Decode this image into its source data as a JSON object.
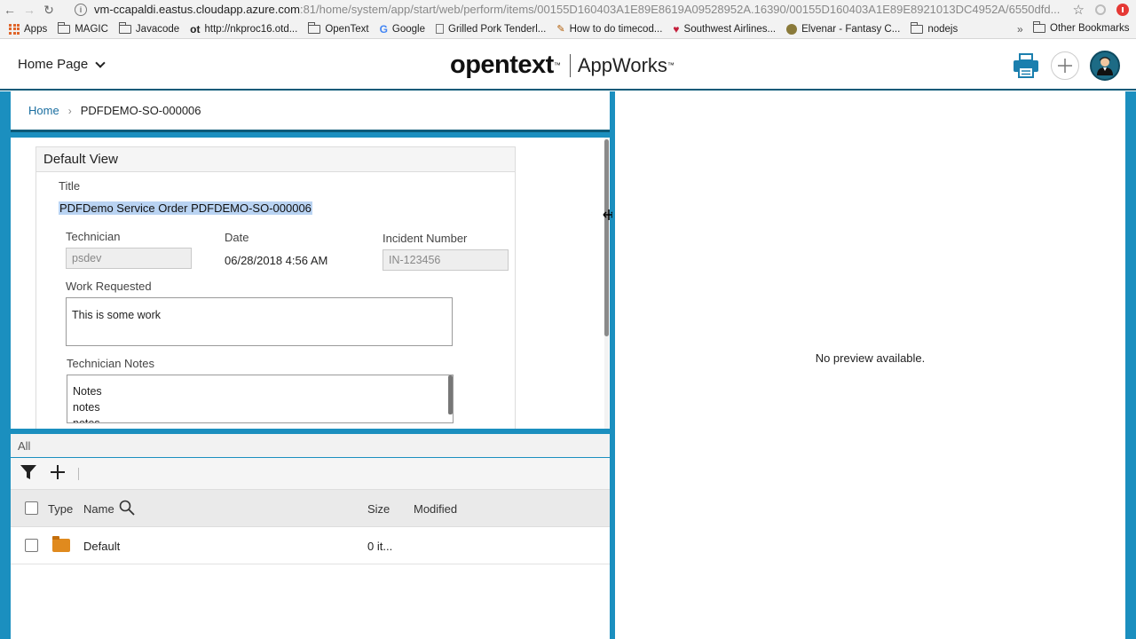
{
  "browser": {
    "url_host": "vm-ccapaldi.eastus.cloudapp.azure.com",
    "url_path": ":81/home/system/app/start/web/perform/items/00155D160403A1E89E8619A09528952A.16390/00155D160403A1E89E8921013DC4952A/6550dfd...",
    "bookmarks": [
      {
        "label": "Apps",
        "icon": "apps-icon"
      },
      {
        "label": "MAGIC",
        "icon": "folder-icon"
      },
      {
        "label": "Javacode",
        "icon": "folder-icon"
      },
      {
        "label": "http://nkproc16.otd...",
        "icon": "ot-icon",
        "icon_text": "ot"
      },
      {
        "label": "OpenText",
        "icon": "folder-icon"
      },
      {
        "label": "Google",
        "icon": "google-icon",
        "icon_text": "G"
      },
      {
        "label": "Grilled Pork Tenderl...",
        "icon": "page-icon"
      },
      {
        "label": "How to do timecod...",
        "icon": "pen-icon",
        "icon_text": "✎"
      },
      {
        "label": "Southwest Airlines...",
        "icon": "heart-icon",
        "icon_text": "♥"
      },
      {
        "label": "Elvenar - Fantasy C...",
        "icon": "elvenar-icon"
      },
      {
        "label": "nodejs",
        "icon": "folder-icon"
      }
    ],
    "more_glyph": "»",
    "other_bookmarks": "Other Bookmarks"
  },
  "header": {
    "home_menu": "Home Page",
    "brand_name": "opentext",
    "brand_tm": "™",
    "brand_product": "AppWorks",
    "brand_product_tm": "™"
  },
  "breadcrumb": {
    "home": "Home",
    "separator": "›",
    "current": "PDFDEMO-SO-000006"
  },
  "form": {
    "view_title": "Default View",
    "title_label": "Title",
    "title_value": "PDFDemo Service Order PDFDEMO-SO-000006",
    "technician_label": "Technician",
    "technician_value": "psdev",
    "date_label": "Date",
    "date_value": "06/28/2018 4:56 AM",
    "incident_label": "Incident Number",
    "incident_value": "IN-123456",
    "work_label": "Work Requested",
    "work_value": "This is some work",
    "notes_label": "Technician Notes",
    "notes_lines": [
      "Notes",
      "notes",
      "notes"
    ]
  },
  "files": {
    "tab_label": "All",
    "columns": {
      "type": "Type",
      "name": "Name",
      "size": "Size",
      "modified": "Modified"
    },
    "rows": [
      {
        "type_icon": "folder-icon",
        "name": "Default",
        "size": "0 it...",
        "modified": ""
      }
    ]
  },
  "preview": {
    "message": "No preview available."
  },
  "colors": {
    "accent": "#1b8fbf",
    "header_border": "#0b5a78",
    "selection": "#b9d3f2",
    "folder": "#e08a1e"
  }
}
